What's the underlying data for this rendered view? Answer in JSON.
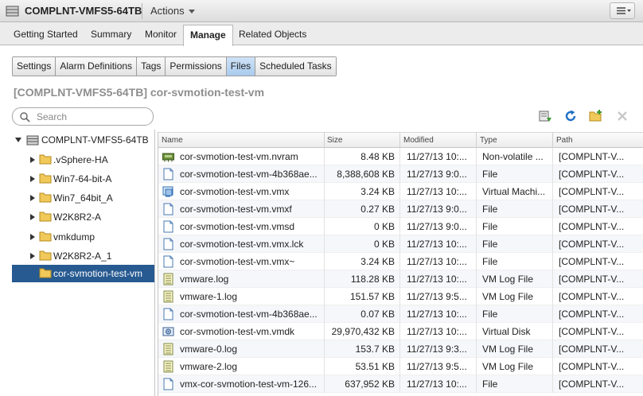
{
  "window": {
    "title": "COMPLNT-VMFS5-64TB",
    "actions_label": "Actions"
  },
  "top_tabs": [
    "Getting Started",
    "Summary",
    "Monitor",
    "Manage",
    "Related Objects"
  ],
  "active_top_tab": "Manage",
  "sub_tabs": [
    "Settings",
    "Alarm Definitions",
    "Tags",
    "Permissions",
    "Files",
    "Scheduled Tasks"
  ],
  "active_sub_tab": "Files",
  "heading": "[COMPLNT-VMFS5-64TB] cor-svmotion-test-vm",
  "search": {
    "placeholder": "Search",
    "value": ""
  },
  "toolbar_icons": [
    "upload-icon",
    "refresh-icon",
    "new-folder-icon",
    "delete-icon"
  ],
  "tree": {
    "root": "COMPLNT-VMFS5-64TB",
    "folders": [
      ".vSphere-HA",
      "Win7-64-bit-A",
      "Win7_64bit_A",
      "W2K8R2-A",
      "vmkdump",
      "W2K8R2-A_1",
      "cor-svmotion-test-vm"
    ],
    "selected": "cor-svmotion-test-vm"
  },
  "table": {
    "headers": [
      "Name",
      "Size",
      "Modified",
      "Type",
      "Path"
    ],
    "rows": [
      {
        "icon": "nvram-icon",
        "name": "cor-svmotion-test-vm.nvram",
        "size": "8.48 KB",
        "modified": "11/27/13 10:...",
        "type": "Non-volatile ...",
        "path": "[COMPLNT-V..."
      },
      {
        "icon": "file-icon",
        "name": "cor-svmotion-test-vm-4b368ae...",
        "size": "8,388,608 KB",
        "modified": "11/27/13 9:0...",
        "type": "File",
        "path": "[COMPLNT-V..."
      },
      {
        "icon": "vm-icon",
        "name": "cor-svmotion-test-vm.vmx",
        "size": "3.24 KB",
        "modified": "11/27/13 10:...",
        "type": "Virtual Machi...",
        "path": "[COMPLNT-V..."
      },
      {
        "icon": "file-icon",
        "name": "cor-svmotion-test-vm.vmxf",
        "size": "0.27 KB",
        "modified": "11/27/13 9:0...",
        "type": "File",
        "path": "[COMPLNT-V..."
      },
      {
        "icon": "file-icon",
        "name": "cor-svmotion-test-vm.vmsd",
        "size": "0 KB",
        "modified": "11/27/13 9:0...",
        "type": "File",
        "path": "[COMPLNT-V..."
      },
      {
        "icon": "file-icon",
        "name": "cor-svmotion-test-vm.vmx.lck",
        "size": "0 KB",
        "modified": "11/27/13 10:...",
        "type": "File",
        "path": "[COMPLNT-V..."
      },
      {
        "icon": "file-icon",
        "name": "cor-svmotion-test-vm.vmx~",
        "size": "3.24 KB",
        "modified": "11/27/13 10:...",
        "type": "File",
        "path": "[COMPLNT-V..."
      },
      {
        "icon": "log-icon",
        "name": "vmware.log",
        "size": "118.28 KB",
        "modified": "11/27/13 10:...",
        "type": "VM Log File",
        "path": "[COMPLNT-V..."
      },
      {
        "icon": "log-icon",
        "name": "vmware-1.log",
        "size": "151.57 KB",
        "modified": "11/27/13 9:5...",
        "type": "VM Log File",
        "path": "[COMPLNT-V..."
      },
      {
        "icon": "file-icon",
        "name": "cor-svmotion-test-vm-4b368ae...",
        "size": "0.07 KB",
        "modified": "11/27/13 10:...",
        "type": "File",
        "path": "[COMPLNT-V..."
      },
      {
        "icon": "disk-icon",
        "name": "cor-svmotion-test-vm.vmdk",
        "size": "29,970,432 KB",
        "modified": "11/27/13 10:...",
        "type": "Virtual Disk",
        "path": "[COMPLNT-V..."
      },
      {
        "icon": "log-icon",
        "name": "vmware-0.log",
        "size": "153.7 KB",
        "modified": "11/27/13 9:3...",
        "type": "VM Log File",
        "path": "[COMPLNT-V..."
      },
      {
        "icon": "log-icon",
        "name": "vmware-2.log",
        "size": "53.51 KB",
        "modified": "11/27/13 9:5...",
        "type": "VM Log File",
        "path": "[COMPLNT-V..."
      },
      {
        "icon": "file-icon",
        "name": "vmx-cor-svmotion-test-vm-126...",
        "size": "637,952 KB",
        "modified": "11/27/13 10:...",
        "type": "File",
        "path": "[COMPLNT-V..."
      }
    ]
  },
  "colors": {
    "selection": "#275a91",
    "active_subtab": "#a9cbee",
    "heading": "#8e8e8e"
  }
}
